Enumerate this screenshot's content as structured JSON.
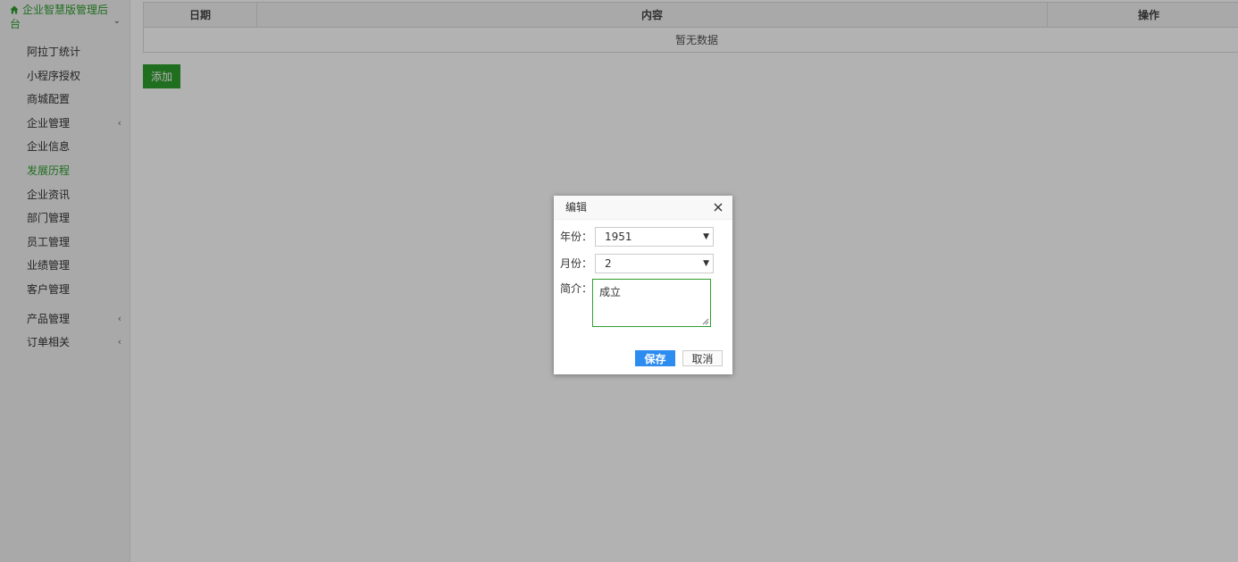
{
  "sidebar": {
    "brand_title": "企业智慧版管理后台",
    "items": [
      {
        "label": "阿拉丁统计"
      },
      {
        "label": "小程序授权"
      },
      {
        "label": "商城配置"
      },
      {
        "label": "企业管理",
        "caret": "‹"
      },
      {
        "label": "企业信息"
      },
      {
        "label": "发展历程"
      },
      {
        "label": "企业资讯"
      },
      {
        "label": "部门管理"
      },
      {
        "label": "员工管理"
      },
      {
        "label": "业绩管理"
      },
      {
        "label": "客户管理"
      },
      {
        "label": "产品管理",
        "caret": "‹"
      },
      {
        "label": "订单相关",
        "caret": "‹"
      }
    ],
    "active_label": "发展历程",
    "brand_color": "#2e9e2e"
  },
  "table": {
    "headers": [
      "日期",
      "内容",
      "操作"
    ],
    "empty_text": "暂无数据"
  },
  "toolbar": {
    "add_label": "添加"
  },
  "dialog": {
    "title": "编辑",
    "year": {
      "label": "年份：",
      "value": "1951"
    },
    "month": {
      "label": "月份：",
      "value": "2"
    },
    "intro": {
      "label": "简介：",
      "value": "成立"
    },
    "save_label": "保存",
    "cancel_label": "取消",
    "save_color": "#2d8cf0"
  }
}
